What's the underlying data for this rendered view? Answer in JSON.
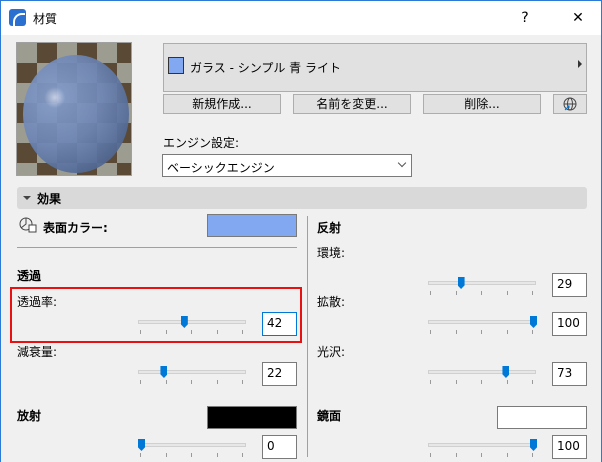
{
  "window": {
    "title": "材質",
    "help_label": "?",
    "close_label": "✕"
  },
  "material": {
    "name": "ガラス - シンプル 青 ライト",
    "swatch_color": "#83a8f2"
  },
  "buttons": {
    "new": "新規作成...",
    "rename": "名前を変更...",
    "delete": "削除...",
    "globe_icon": "globe-link-icon"
  },
  "engine": {
    "label": "エンジン設定:",
    "value": "ベーシックエンジン"
  },
  "section": {
    "title": "効果"
  },
  "surface": {
    "label": "表面カラー:",
    "color": "#83a8f2"
  },
  "transparency": {
    "heading": "透過",
    "rate_label": "透過率:",
    "rate": 42,
    "rate_text": "42",
    "falloff_label": "減衰量:",
    "falloff": 22,
    "falloff_text": "22"
  },
  "emission": {
    "heading": "放射",
    "color": "#000000",
    "value": 0,
    "value_text": "0"
  },
  "reflection": {
    "heading": "反射",
    "ambient_label": "環境:",
    "ambient": 29,
    "ambient_text": "29",
    "diffuse_label": "拡散:",
    "diffuse": 100,
    "diffuse_text": "100",
    "shine_label": "光沢:",
    "shine": 73,
    "shine_text": "73"
  },
  "specular": {
    "heading": "鏡面",
    "color": "#ffffff",
    "value": 100,
    "value_text": "100"
  },
  "accent": "#0078d7"
}
